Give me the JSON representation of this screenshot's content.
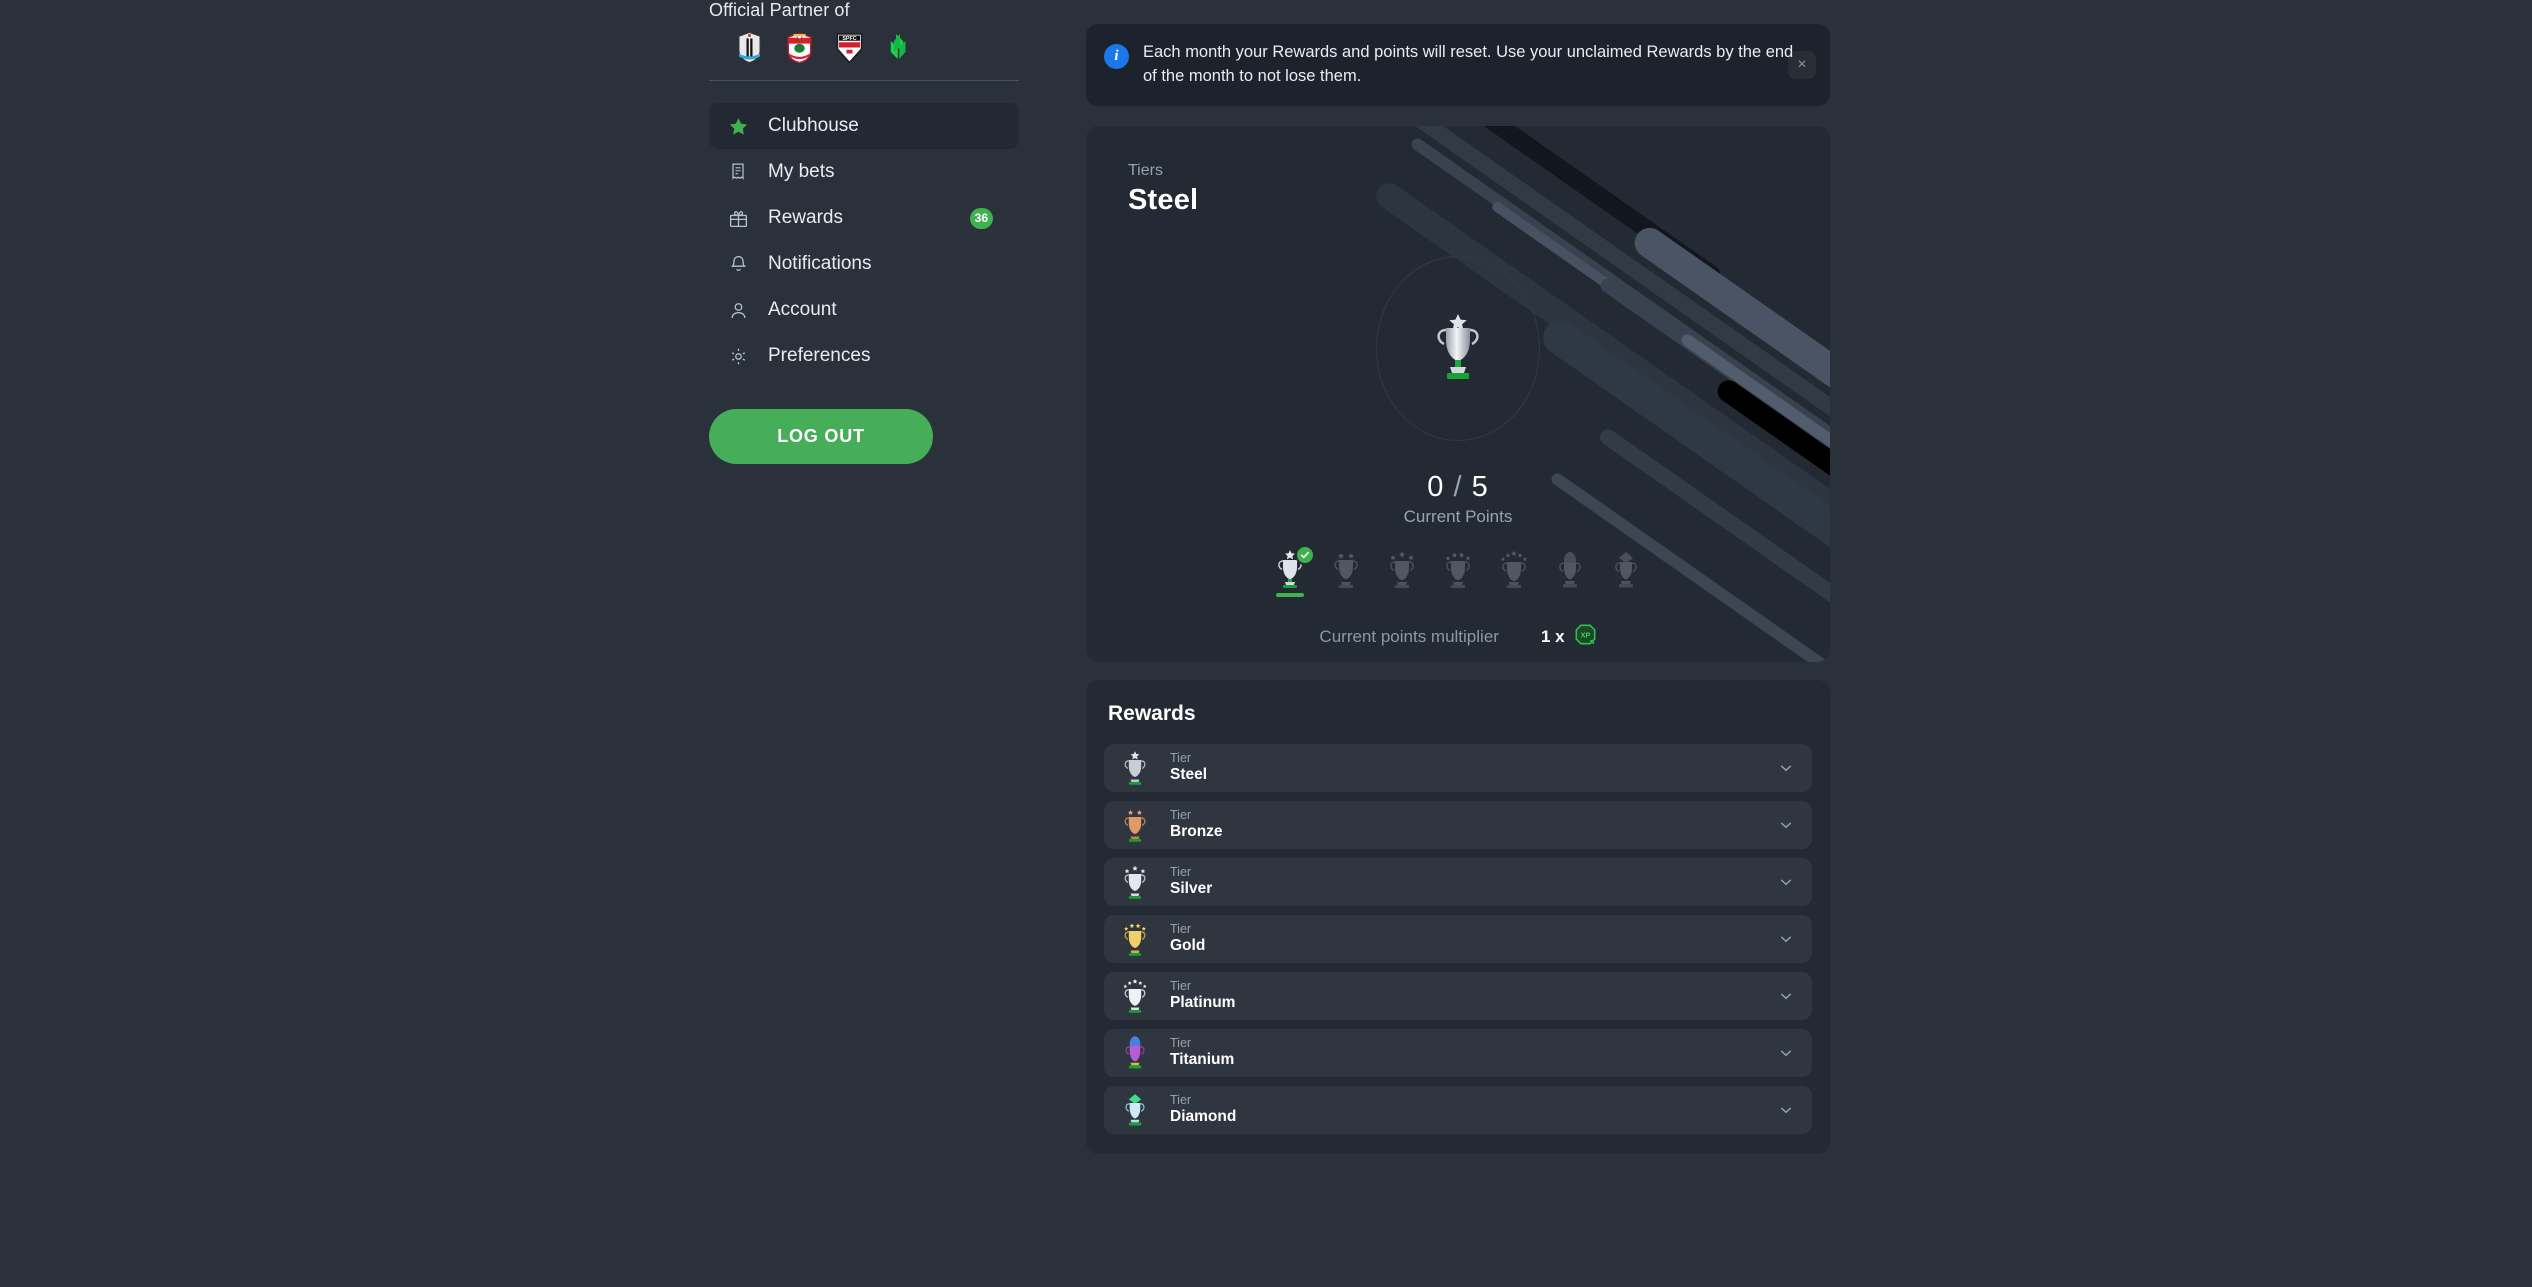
{
  "sidebar": {
    "partner_title": "Official Partner of",
    "crests": [
      {
        "name": "newcastle-united-crest"
      },
      {
        "name": "southampton-crest"
      },
      {
        "name": "sao-paulo-fc-crest"
      },
      {
        "name": "partner-logo-green"
      }
    ],
    "items": [
      {
        "label": "Clubhouse",
        "icon": "star-icon",
        "active": true,
        "badge": ""
      },
      {
        "label": "My bets",
        "icon": "receipt-icon",
        "active": false,
        "badge": ""
      },
      {
        "label": "Rewards",
        "icon": "gift-icon",
        "active": false,
        "badge": "36"
      },
      {
        "label": "Notifications",
        "icon": "bell-icon",
        "active": false,
        "badge": ""
      },
      {
        "label": "Account",
        "icon": "user-icon",
        "active": false,
        "badge": ""
      },
      {
        "label": "Preferences",
        "icon": "gear-icon",
        "active": false,
        "badge": ""
      }
    ],
    "logout_label": "LOG OUT"
  },
  "banner": {
    "icon": "info-icon",
    "text": "Each month your Rewards and points will reset. Use your unclaimed Rewards by the end of the month to not lose them.",
    "close_label": "×"
  },
  "tier_card": {
    "kicker": "Tiers",
    "name": "Steel",
    "points_current": "0",
    "points_separator": "/",
    "points_target": "5",
    "points_label": "Current Points",
    "multiplier_label": "Current points multiplier",
    "multiplier_value": "1 x",
    "multiplier_badge": "XP",
    "trophies": [
      {
        "tier": "Steel",
        "active": true
      },
      {
        "tier": "Bronze",
        "active": false
      },
      {
        "tier": "Silver",
        "active": false
      },
      {
        "tier": "Gold",
        "active": false
      },
      {
        "tier": "Platinum",
        "active": false
      },
      {
        "tier": "Titanium",
        "active": false
      },
      {
        "tier": "Diamond",
        "active": false
      }
    ]
  },
  "rewards": {
    "title": "Rewards",
    "row_kicker": "Tier",
    "rows": [
      {
        "kicker": "Tier",
        "name": "Steel",
        "cup": "#c9ced6",
        "cup2": "#8d949f",
        "stars": 1
      },
      {
        "kicker": "Tier",
        "name": "Bronze",
        "cup": "#e8a578",
        "cup2": "#b06e3f",
        "stars": 2
      },
      {
        "kicker": "Tier",
        "name": "Silver",
        "cup": "#e4e8ee",
        "cup2": "#a2a9b4",
        "stars": 3
      },
      {
        "kicker": "Tier",
        "name": "Gold",
        "cup": "#f0d878",
        "cup2": "#bb9733",
        "stars": 4
      },
      {
        "kicker": "Tier",
        "name": "Platinum",
        "cup": "#f2f4f8",
        "cup2": "#b9c0cb",
        "stars": 5
      },
      {
        "kicker": "Tier",
        "name": "Titanium",
        "cup": "#c06bd8",
        "cup2": "#7b3f99",
        "stars": 0
      },
      {
        "kicker": "Tier",
        "name": "Diamond",
        "cup": "#bfe6f5",
        "cup2": "#79c3e0",
        "stars": 0
      }
    ]
  },
  "colors": {
    "page_bg": "#2a313a",
    "card_bg": "#242a33",
    "row_bg": "#2f3640",
    "banner_bg": "#1d232c",
    "accent_green": "#3fb14f",
    "logout_green": "#46ae58",
    "info_blue": "#1b78e8",
    "text_primary": "#ffffff",
    "text_muted": "#98a1ad"
  }
}
